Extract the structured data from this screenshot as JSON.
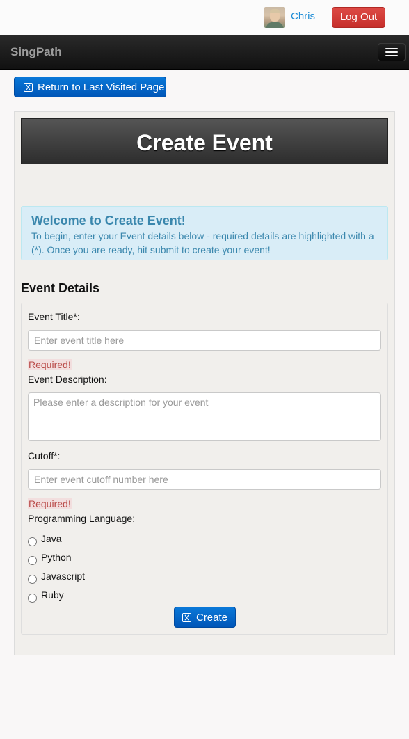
{
  "topbar": {
    "username": "Chris",
    "logout_label": "Log Out"
  },
  "navbar": {
    "brand": "SingPath"
  },
  "return_button_label": "Return to Last Visited Page",
  "page_title": "Create Event",
  "info": {
    "heading": "Welcome to Create Event!",
    "text": "To begin, enter your Event details below - required details are highlighted with a (*). Once you are ready, hit submit to create your event!"
  },
  "section_title": "Event Details",
  "form": {
    "title_label": "Event Title*:",
    "title_placeholder": "Enter event title here",
    "title_required": "Required!",
    "description_label": "Event Description:",
    "description_placeholder": "Please enter a description for your event",
    "cutoff_label": "Cutoff*:",
    "cutoff_placeholder": "Enter event cutoff number here",
    "cutoff_required": "Required!",
    "language_label": "Programming Language:",
    "languages": [
      "Java",
      "Python",
      "Javascript",
      "Ruby"
    ],
    "create_label": "Create"
  },
  "colors": {
    "primary": "#0a6fd0",
    "danger": "#d43f3a",
    "info_bg": "#d9edf7",
    "info_text": "#3a87ad",
    "link": "#1f8dd6"
  }
}
